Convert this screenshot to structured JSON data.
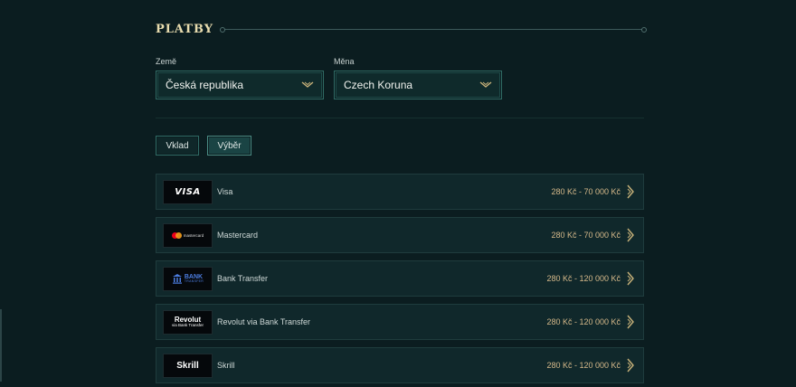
{
  "section": {
    "title": "PLATBY"
  },
  "filters": {
    "country": {
      "label": "Země",
      "value": "Česká republika"
    },
    "currency": {
      "label": "Měna",
      "value": "Czech Koruna"
    }
  },
  "tabs": [
    {
      "label": "Vklad"
    },
    {
      "label": "Výběr",
      "active": true
    }
  ],
  "methods": [
    {
      "name": "Visa",
      "range": "280 Kč - 70 000 Kč",
      "logo": {
        "type": "visa",
        "text": "VISA"
      }
    },
    {
      "name": "Mastercard",
      "range": "280 Kč - 70 000 Kč",
      "logo": {
        "type": "mastercard",
        "text": "mastercard"
      }
    },
    {
      "name": "Bank Transfer",
      "range": "280 Kč - 120 000 Kč",
      "logo": {
        "type": "bank",
        "text": "BANK",
        "sub": "TRANSFER"
      }
    },
    {
      "name": "Revolut via Bank Transfer",
      "range": "280 Kč - 120 000 Kč",
      "logo": {
        "type": "revolut",
        "text": "Revolut",
        "sub": "via Bank Transfer"
      }
    },
    {
      "name": "Skrill",
      "range": "280 Kč - 120 000 Kč",
      "logo": {
        "type": "skrill",
        "text": "Skrill"
      }
    }
  ],
  "colors": {
    "background": "#0b1d20",
    "accent": "#2f6a64",
    "title": "#e8dcae",
    "range": "#d6b98a"
  },
  "icons": {
    "dropdown": "chevron-down-icon",
    "row_arrow": "chevron-right-icon"
  }
}
